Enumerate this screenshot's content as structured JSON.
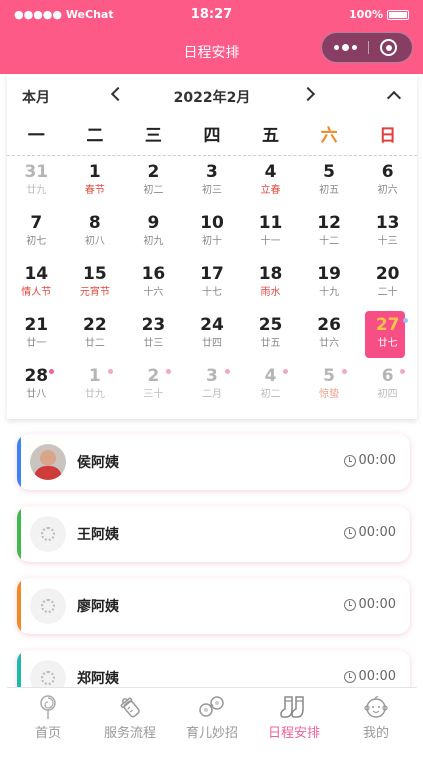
{
  "status_bar": {
    "carrier": "●●●●● WeChat",
    "time": "18:27",
    "battery": "100%"
  },
  "nav": {
    "title": "日程安排"
  },
  "calendar": {
    "month_button": "本月",
    "current_month": "2022年2月",
    "weekdays": [
      "一",
      "二",
      "三",
      "四",
      "五",
      "六",
      "日"
    ],
    "weeks": [
      [
        {
          "num": "31",
          "lunar": "廿九",
          "muted": true
        },
        {
          "num": "1",
          "lunar": "春节",
          "festival": true
        },
        {
          "num": "2",
          "lunar": "初二"
        },
        {
          "num": "3",
          "lunar": "初三"
        },
        {
          "num": "4",
          "lunar": "立春",
          "festival": true
        },
        {
          "num": "5",
          "lunar": "初五"
        },
        {
          "num": "6",
          "lunar": "初六"
        }
      ],
      [
        {
          "num": "7",
          "lunar": "初七"
        },
        {
          "num": "8",
          "lunar": "初八"
        },
        {
          "num": "9",
          "lunar": "初九"
        },
        {
          "num": "10",
          "lunar": "初十"
        },
        {
          "num": "11",
          "lunar": "十一"
        },
        {
          "num": "12",
          "lunar": "十二"
        },
        {
          "num": "13",
          "lunar": "十三"
        }
      ],
      [
        {
          "num": "14",
          "lunar": "情人节",
          "festival": true
        },
        {
          "num": "15",
          "lunar": "元宵节",
          "festival": true
        },
        {
          "num": "16",
          "lunar": "十六"
        },
        {
          "num": "17",
          "lunar": "十七"
        },
        {
          "num": "18",
          "lunar": "雨水",
          "festival": true
        },
        {
          "num": "19",
          "lunar": "十九"
        },
        {
          "num": "20",
          "lunar": "二十"
        }
      ],
      [
        {
          "num": "21",
          "lunar": "廿一"
        },
        {
          "num": "22",
          "lunar": "廿二"
        },
        {
          "num": "23",
          "lunar": "廿三"
        },
        {
          "num": "24",
          "lunar": "廿四"
        },
        {
          "num": "25",
          "lunar": "廿五"
        },
        {
          "num": "26",
          "lunar": "廿六"
        },
        {
          "num": "27",
          "lunar": "廿七",
          "selected": true,
          "dot": true
        }
      ],
      [
        {
          "num": "28",
          "lunar": "廿八",
          "dot": true
        },
        {
          "num": "1",
          "lunar": "廿九",
          "muted": true,
          "dot": true
        },
        {
          "num": "2",
          "lunar": "三十",
          "muted": true,
          "dot": true
        },
        {
          "num": "3",
          "lunar": "二月",
          "muted": true,
          "dot": true
        },
        {
          "num": "4",
          "lunar": "初二",
          "muted": true,
          "dot": true
        },
        {
          "num": "5",
          "lunar": "惊蛰",
          "muted": true,
          "festival": true,
          "dot": true
        },
        {
          "num": "6",
          "lunar": "初四",
          "muted": true,
          "dot": true
        }
      ]
    ]
  },
  "schedule": [
    {
      "name": "侯阿姨",
      "time": "00:00",
      "color": "#3b82f6",
      "avatar": "photo"
    },
    {
      "name": "王阿姨",
      "time": "00:00",
      "color": "#3fb950",
      "avatar": "placeholder"
    },
    {
      "name": "廖阿姨",
      "time": "00:00",
      "color": "#f08a25",
      "avatar": "placeholder"
    },
    {
      "name": "郑阿姨",
      "time": "00:00",
      "color": "#1fb9b0",
      "avatar": "placeholder"
    }
  ],
  "tabs": [
    {
      "label": "首页",
      "icon": "lollipop-icon"
    },
    {
      "label": "服务流程",
      "icon": "baby-bottle-icon"
    },
    {
      "label": "育儿妙招",
      "icon": "rattle-icon"
    },
    {
      "label": "日程安排",
      "icon": "baby-socks-icon",
      "active": true
    },
    {
      "label": "我的",
      "icon": "baby-face-icon"
    }
  ],
  "colors": {
    "accent": "#fd5a88",
    "selected_bg": "#f74e86",
    "festival": "#e5483d",
    "saturday": "#f08a25",
    "sunday": "#e33d3d"
  }
}
